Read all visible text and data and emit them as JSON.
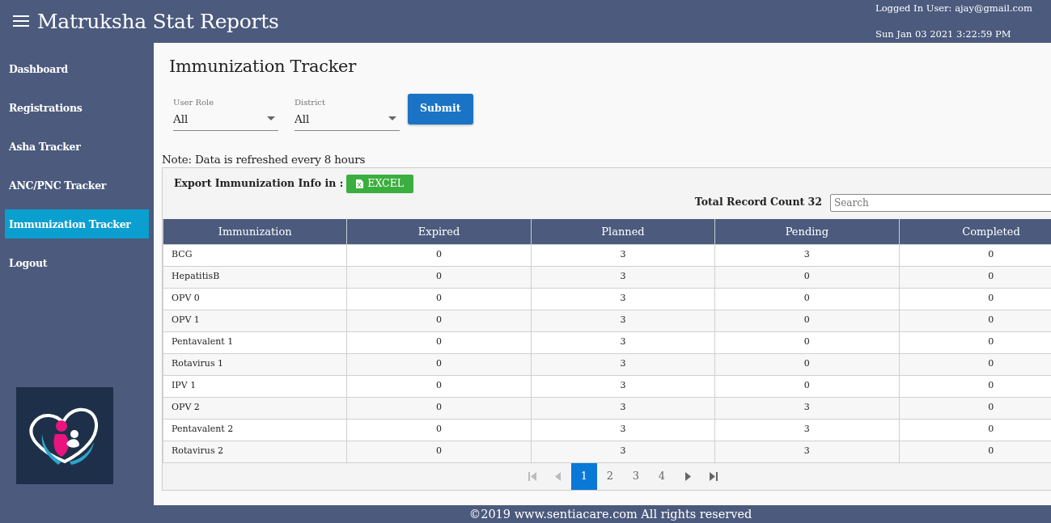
{
  "header": {
    "title": "Matruksha Stat Reports",
    "user": "Logged In User: ajay@gmail.com",
    "datetime": "Sun Jan 03 2021 3:22:59 PM"
  },
  "sidebar": {
    "items": [
      {
        "label": "Dashboard",
        "selected": false
      },
      {
        "label": "Registrations",
        "selected": false
      },
      {
        "label": "Asha Tracker",
        "selected": false
      },
      {
        "label": "ANC/PNC Tracker",
        "selected": false
      },
      {
        "label": "Immunization Tracker",
        "selected": true
      },
      {
        "label": "Logout",
        "selected": false
      }
    ]
  },
  "page_title": "Immunization Tracker",
  "filters": [
    {
      "label": "User Role",
      "value": "All"
    },
    {
      "label": "District",
      "value": "All"
    }
  ],
  "submit": "Submit",
  "note": "Note: Data is refreshed every 8 hours",
  "export": {
    "label": "Export Immunization Info in :",
    "button": "EXCEL"
  },
  "record_count": "Total Record Count 32",
  "search": {
    "placeholder": "Search"
  },
  "table": {
    "columns": [
      "Immunization",
      "Expired",
      "Planned",
      "Pending",
      "Completed"
    ],
    "rows": [
      [
        "BCG",
        "0",
        "3",
        "3",
        "0"
      ],
      [
        "HepatitisB",
        "0",
        "3",
        "0",
        "0"
      ],
      [
        "OPV 0",
        "0",
        "3",
        "0",
        "0"
      ],
      [
        "OPV 1",
        "0",
        "3",
        "0",
        "0"
      ],
      [
        "Pentavalent 1",
        "0",
        "3",
        "0",
        "0"
      ],
      [
        "Rotavirus 1",
        "0",
        "3",
        "0",
        "0"
      ],
      [
        "IPV 1",
        "0",
        "3",
        "0",
        "0"
      ],
      [
        "OPV 2",
        "0",
        "3",
        "3",
        "0"
      ],
      [
        "Pentavalent 2",
        "0",
        "3",
        "3",
        "0"
      ],
      [
        "Rotavirus 2",
        "0",
        "3",
        "3",
        "0"
      ]
    ]
  },
  "pager": {
    "first_disabled": true,
    "prev_disabled": true,
    "next_disabled": false,
    "last_disabled": false,
    "pages": [
      {
        "label": "1",
        "selected": true
      },
      {
        "label": "2",
        "selected": false
      },
      {
        "label": "3",
        "selected": false
      },
      {
        "label": "4",
        "selected": false
      }
    ]
  },
  "footer": "©2019 www.sentiacare.com All rights reserved"
}
